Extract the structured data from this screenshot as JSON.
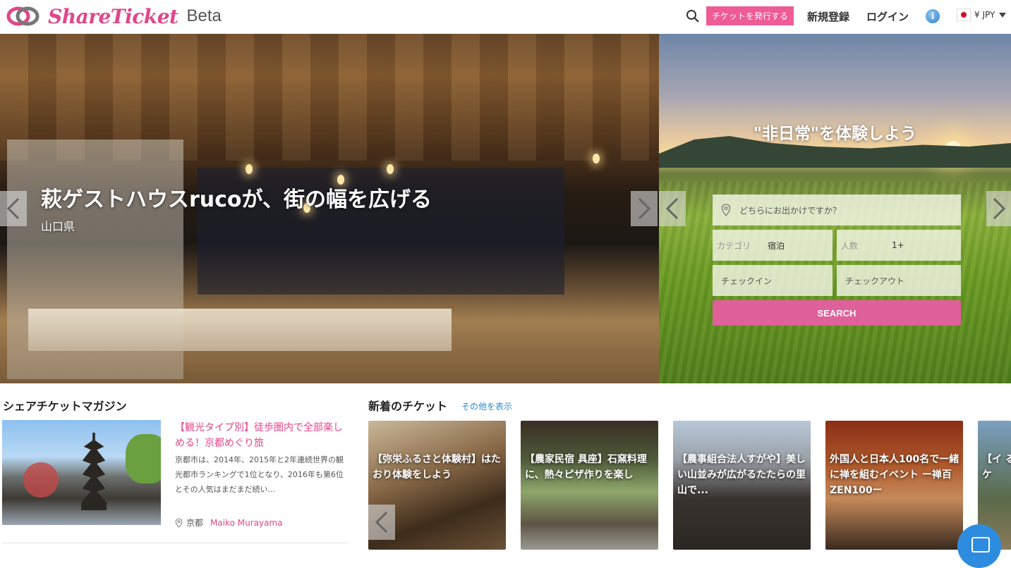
{
  "header": {
    "logo_text": "ShareTicket",
    "beta": "Beta",
    "issue_button": "チケットを発行する",
    "signup": "新規登録",
    "login": "ログイン",
    "info": "i",
    "currency": "¥ JPY",
    "accent_color": "#ee5b95"
  },
  "hero": {
    "title": "萩ゲストハウスrucoが、街の幅を広げる",
    "location": "山口県",
    "tagline": "\"非日常\"を体験しよう"
  },
  "search": {
    "destination_placeholder": "どちらにお出かけですか？",
    "category_label": "カテゴリ",
    "category_value": "宿泊",
    "people_label": "人数",
    "people_value": "1+",
    "checkin": "チェックイン",
    "checkout": "チェックアウト",
    "button": "SEARCH"
  },
  "magazine": {
    "heading": "シェアチケットマガジン",
    "title": "【観光タイプ別】徒歩圏内で全部楽しめる！京都めぐり旅",
    "description": "京都市は、2014年、2015年と2年連続世界の観光都市ランキングで1位となり、2016年も第6位とその人気はまだまだ続い...",
    "location": "京都",
    "author": "Maiko Murayama"
  },
  "tickets": {
    "heading": "新着のチケット",
    "more": "その他を表示",
    "items": [
      {
        "title": "【弥栄ふるさと体験村】はたおり体験をしよう"
      },
      {
        "title": "【農家民宿 具座】石窯料理に、熱々ピザ作りを楽し"
      },
      {
        "title": "【農事組合法人すがや】美しい山並みが広がるたたらの里山で..."
      },
      {
        "title": "外国人と日本人100名で一緒に禅を組むイベント ー禅百 ZEN100ー"
      },
      {
        "title": "【イ るケ"
      }
    ]
  }
}
